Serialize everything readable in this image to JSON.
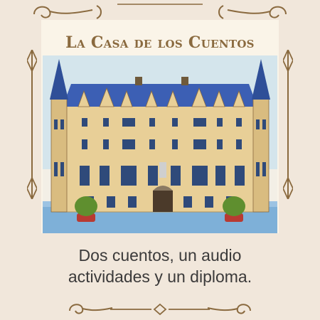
{
  "title": "La Casa de los Cuentos",
  "caption_line1": "Dos cuentos, un audio",
  "caption_line2": "actividades y un diploma.",
  "colors": {
    "background": "#f1e7db",
    "card": "#faf4e8",
    "ornament": "#8a6a3f",
    "roof": "#3c5fb4",
    "facade": "#e8cf97",
    "sky": "#b9dcf0",
    "ground": "#7eb0d8"
  },
  "icons": [
    "flourish-icon",
    "building-illustration"
  ]
}
